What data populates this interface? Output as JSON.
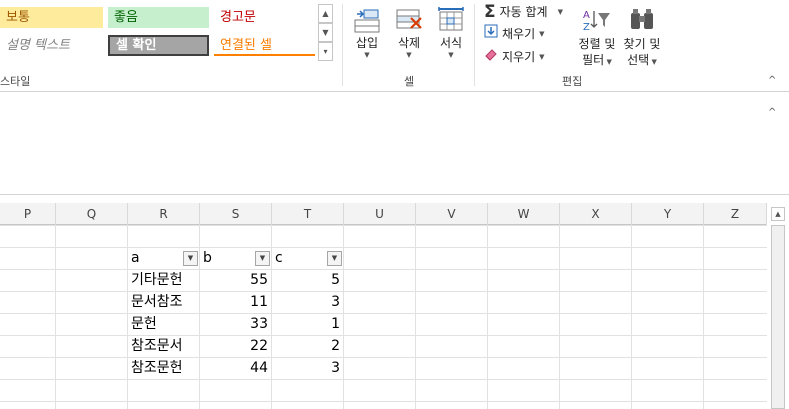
{
  "ribbon": {
    "styles": {
      "bad": "보통",
      "good": "좋음",
      "warning": "경고문",
      "explanatory": "설명 텍스트",
      "check_cell": "셀 확인",
      "linked_cell": "연결된 셀",
      "group_label": "스타일"
    },
    "cells": {
      "insert": "삽입",
      "delete": "삭제",
      "format": "서식",
      "group_label": "셀"
    },
    "editing": {
      "autosum": "자동 합계",
      "fill": "채우기",
      "clear": "지우기",
      "sort_filter_line1": "정렬 및",
      "sort_filter_line2": "필터",
      "find_select_line1": "찾기 및",
      "find_select_line2": "선택",
      "group_label": "편집"
    }
  },
  "columns": [
    "P",
    "Q",
    "R",
    "S",
    "T",
    "U",
    "V",
    "W",
    "X",
    "Y",
    "Z"
  ],
  "table": {
    "headers": [
      "a",
      "b",
      "c"
    ],
    "rows": [
      [
        "기타문헌",
        "55",
        "5"
      ],
      [
        "문서참조",
        "11",
        "3"
      ],
      [
        "문헌",
        "33",
        "1"
      ],
      [
        "참조문서",
        "22",
        "2"
      ],
      [
        "참조문헌",
        "44",
        "3"
      ]
    ]
  },
  "colors": {
    "bad_fill": "#ffeb9c",
    "good_fill": "#c6efce",
    "check_fill": "#a5a5a5",
    "warning_text": "#c00000",
    "linked_text": "#fa7d00"
  }
}
